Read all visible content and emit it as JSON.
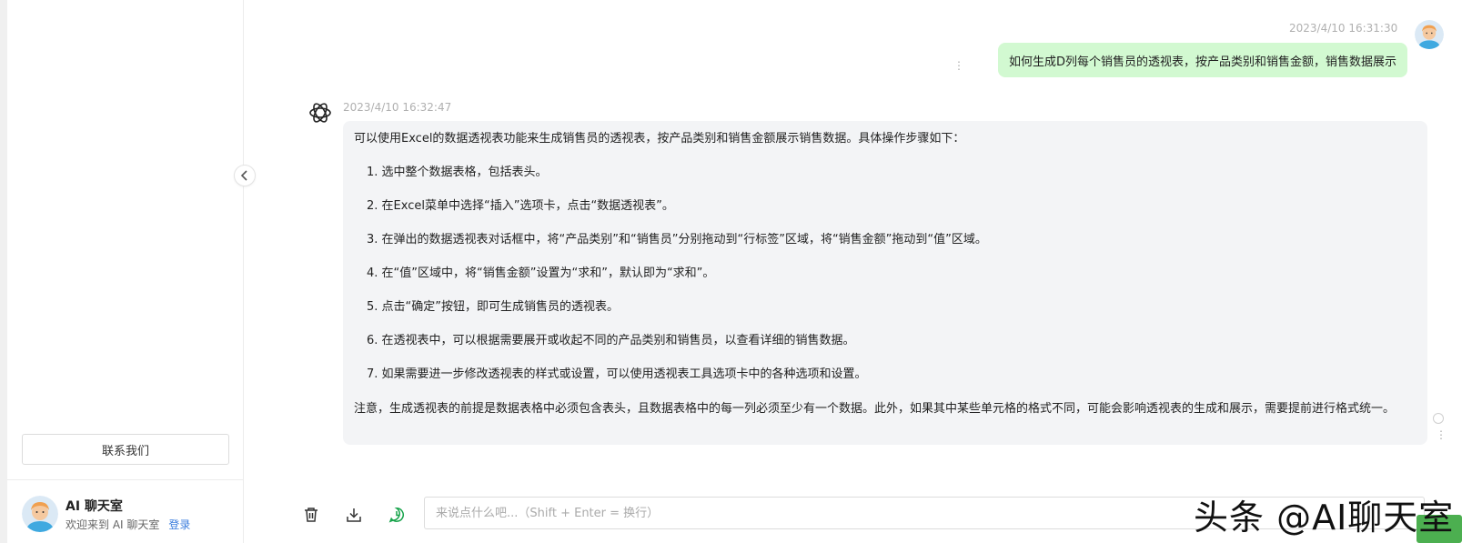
{
  "sidebar": {
    "contact_button": "联系我们",
    "user": {
      "name": "AI 聊天室",
      "welcome": "欢迎来到 AI 聊天室",
      "login": "登录"
    }
  },
  "conversation": {
    "user_message": {
      "time": "2023/4/10 16:31:30",
      "text": "如何生成D列每个销售员的透视表，按产品类别和销售金额，销售数据展示"
    },
    "bot_message": {
      "time": "2023/4/10 16:32:47",
      "intro": "可以使用Excel的数据透视表功能来生成销售员的透视表，按产品类别和销售金额展示销售数据。具体操作步骤如下：",
      "steps": [
        "1. 选中整个数据表格，包括表头。",
        "2. 在Excel菜单中选择“插入”选项卡，点击“数据透视表”。",
        "3. 在弹出的数据透视表对话框中，将“产品类别”和“销售员”分别拖动到“行标签”区域，将“销售金额”拖动到“值”区域。",
        "4. 在“值”区域中，将“销售金额”设置为“求和”，默认即为“求和”。",
        "5. 点击“确定”按钮，即可生成销售员的透视表。",
        "6. 在透视表中，可以根据需要展开或收起不同的产品类别和销售员，以查看详细的销售数据。",
        "7. 如果需要进一步修改透视表的样式或设置，可以使用透视表工具选项卡中的各种选项和设置。"
      ],
      "note": "注意，生成透视表的前提是数据表格中必须包含表头，且数据表格中的每一列必须至少有一个数据。此外，如果其中某些单元格的格式不同，可能会影响透视表的生成和展示，需要提前进行格式统一。"
    }
  },
  "input": {
    "placeholder": "来说点什么吧...（Shift + Enter = 换行）",
    "value": ""
  },
  "watermark": "头条 @AI聊天室",
  "icons": {
    "collapse": "chevron-left-icon",
    "delete": "trash-icon",
    "download": "download-icon",
    "whatsapp": "whatsapp-icon",
    "bot": "openai-logo-icon"
  },
  "colors": {
    "user_bubble": "#d2f9d1",
    "bot_bubble": "#f3f4f6",
    "accent": "#4caf50",
    "link": "#3b7ddd"
  }
}
